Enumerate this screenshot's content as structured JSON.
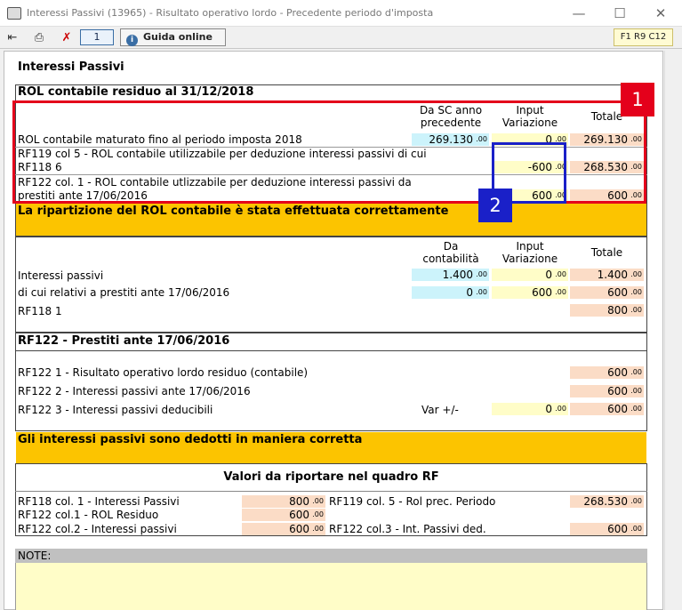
{
  "window": {
    "title": "Interessi Passivi (13965) - Risultato operativo lordo - Precedente periodo d'imposta",
    "minimize": "—",
    "maximize": "☐",
    "close": "✕"
  },
  "toolbar": {
    "page": "1",
    "guida": "Guida online",
    "ref": "F1 R9 C12"
  },
  "doc": {
    "title": "Interessi Passivi",
    "section1": {
      "title": "ROL contabile residuo al 31/12/2018",
      "col1": [
        "Da SC anno",
        "precedente"
      ],
      "col2": [
        "Input",
        "Variazione"
      ],
      "col3": "Totale",
      "row1": {
        "label": "ROL contabile maturato fino al periodo imposta 2018",
        "v1": "269.130",
        "v2": "0",
        "v3": "269.130"
      },
      "row2": {
        "label1": "RF119 col 5  - ROL contabile utilizzabile per deduzione interessi passivi di cui",
        "label2": "RF118  6",
        "v2": "-600",
        "v3": "268.530"
      },
      "row3": {
        "label1": "RF122 col. 1 - ROL contabile utlizzabile per deduzione interessi passivi da",
        "label2": "prestiti ante 17/06/2016",
        "v2": "600",
        "v3": "600"
      },
      "msg": "La ripartizione del ROL contabile è stata effettuata correttamente"
    },
    "section2": {
      "col1": [
        "Da",
        "contabilità"
      ],
      "col2": [
        "Input",
        "Variazione"
      ],
      "col3": "Totale",
      "row1": {
        "label": "Interessi passivi",
        "v1": "1.400",
        "v2": "0",
        "v3": "1.400"
      },
      "row2": {
        "label": "di cui relativi a prestiti ante 17/06/2016",
        "v1": "0",
        "v2": "600",
        "v3": "600"
      },
      "row3": {
        "label": "RF118  1",
        "v3": "800"
      }
    },
    "section3": {
      "title": "RF122 - Prestiti ante 17/06/2016",
      "row1": {
        "label": "RF122  1 - Risultato operativo lordo residuo  (contabile)",
        "v": "600"
      },
      "row2": {
        "label": "RF122  2 - Interessi passivi ante 17/06/2016",
        "v": "600"
      },
      "row3": {
        "label": "RF122  3 -  Interessi passivi deducibili",
        "var": "Var +/-",
        "v2": "0",
        "v3": "600"
      },
      "msg": "Gli interessi passivi sono dedotti in maniera corretta"
    },
    "section4": {
      "title": "Valori da riportare nel quadro RF",
      "r1l": "RF118 col. 1 - Interessi Passivi",
      "r1v": "800",
      "r1l2": "RF119 col. 5 - Rol prec. Periodo",
      "r1v2": "268.530",
      "r2l": "RF122 col.1 - ROL Residuo",
      "r2v": "600",
      "r3l": "RF122 col.2 - Interessi passivi",
      "r3v": "600",
      "r3l2": "RF122 col.3 - Int. Passivi ded.",
      "r3v2": "600"
    },
    "note": "NOTE:",
    "dec": ".00"
  },
  "annotations": {
    "badge1": "1",
    "badge2": "2",
    "red": "#e4001b",
    "blue": "#1a20c8"
  }
}
